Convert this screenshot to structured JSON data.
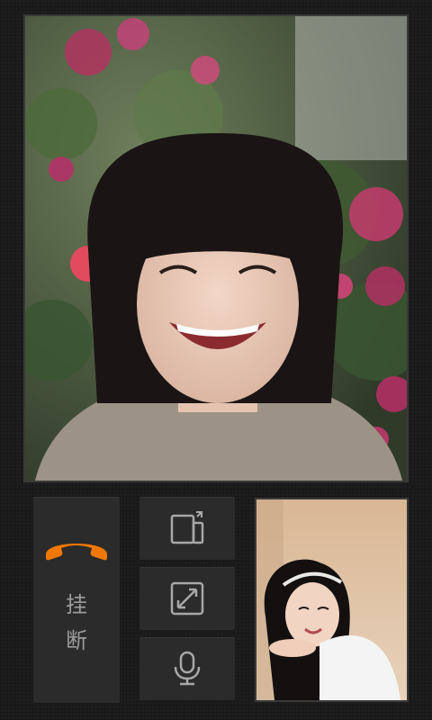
{
  "call": {
    "hangup_label_line1": "挂",
    "hangup_label_line2": "断"
  },
  "colors": {
    "hangup_icon": "#f07800",
    "control_icon": "#a8a8a8",
    "button_bg": "#2b2b2b"
  },
  "icons": {
    "hangup": "phone-hangup-icon",
    "switch_camera": "switch-camera-icon",
    "resize": "resize-arrows-icon",
    "microphone": "microphone-icon"
  }
}
